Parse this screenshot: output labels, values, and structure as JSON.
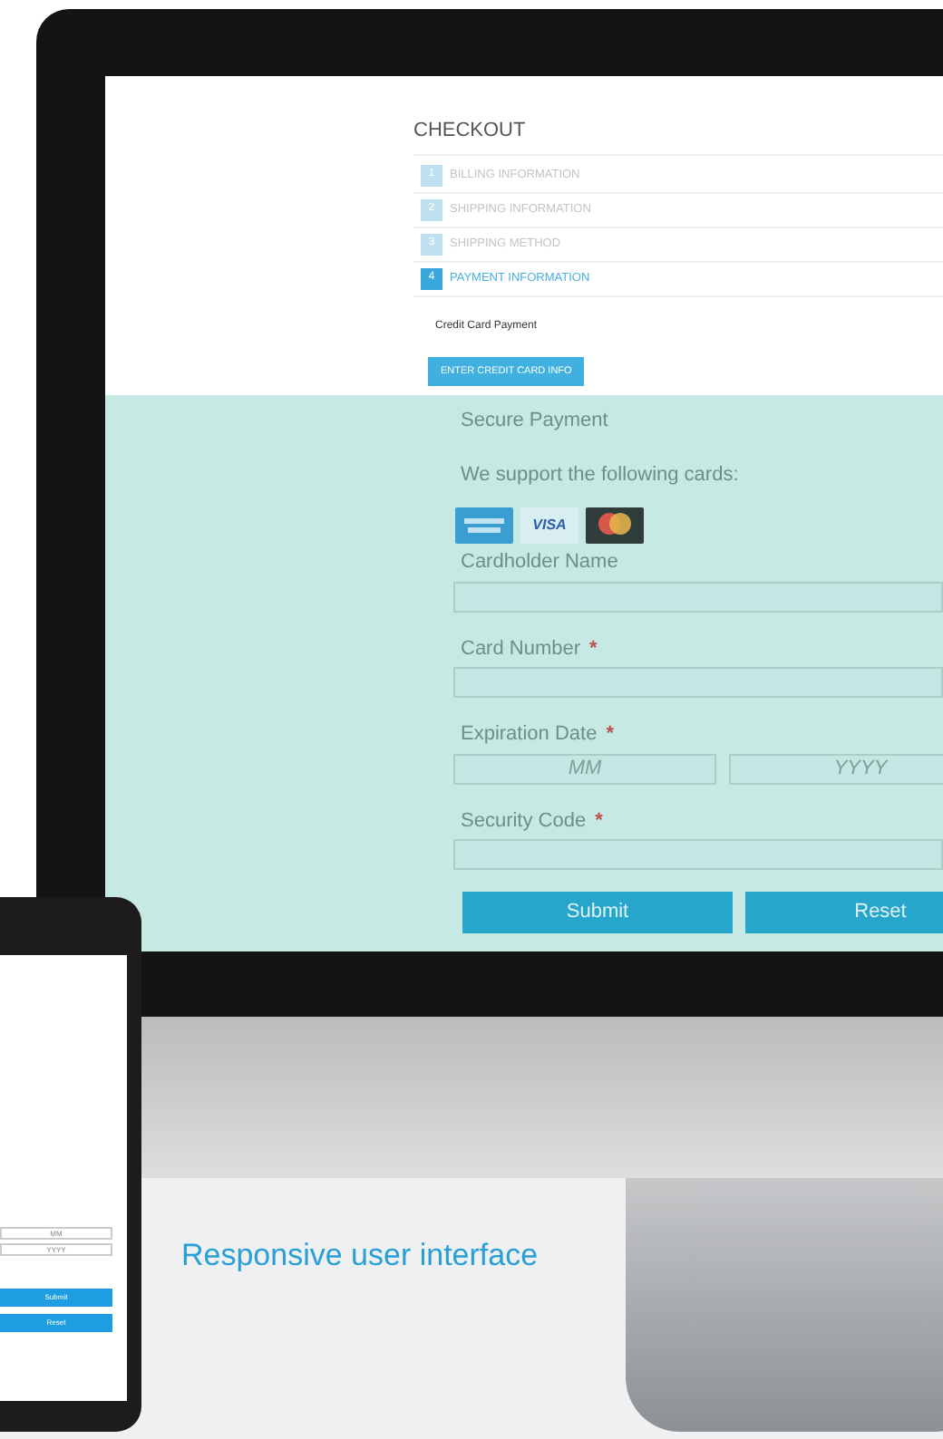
{
  "checkout": {
    "title": "CHECKOUT",
    "steps": [
      {
        "number": "1",
        "label": "BILLING INFORMATION",
        "selected": false
      },
      {
        "number": "2",
        "label": "SHIPPING INFORMATION",
        "selected": false
      },
      {
        "number": "3",
        "label": "SHIPPING METHOD",
        "selected": false
      },
      {
        "number": "4",
        "label": "PAYMENT INFORMATION",
        "selected": true
      }
    ],
    "method": "Credit Card Payment",
    "button": "ENTER CREDIT CARD INFO"
  },
  "payment": {
    "title": "Secure Payment",
    "cards_text": "We support the following cards:",
    "visa_logo": "VISA",
    "fields": [
      {
        "label": "Cardholder Name",
        "kind": "single"
      },
      {
        "label": "Card Number",
        "required_mark": "*",
        "kind": "single"
      },
      {
        "label": "Expiration Date",
        "required_mark": "*",
        "kind": "pair",
        "placeholders": [
          "MM",
          "YYYY"
        ]
      },
      {
        "label": "Security Code",
        "required_mark": "*",
        "kind": "single"
      }
    ],
    "buttons": [
      "Submit",
      "Reset"
    ]
  },
  "phone": {
    "placeholders": [
      "MM",
      "YYYY"
    ],
    "buttons": [
      "Submit",
      "Reset"
    ]
  },
  "caption": "Responsive user interface"
}
